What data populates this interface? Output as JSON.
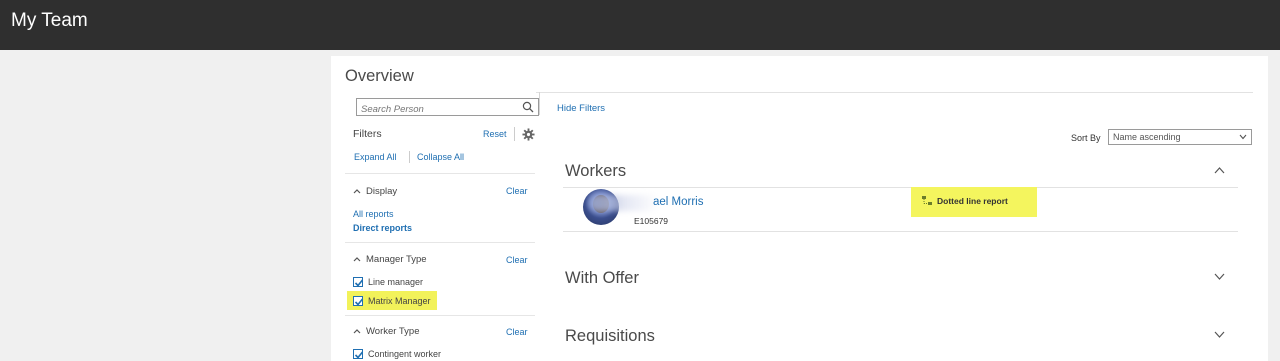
{
  "app": {
    "title": "My Team"
  },
  "overview": {
    "title": "Overview",
    "search_placeholder": "Search Person",
    "hide_filters": "Hide Filters"
  },
  "filters": {
    "label": "Filters",
    "reset": "Reset",
    "expand_all": "Expand All",
    "collapse_all": "Collapse All",
    "display": {
      "label": "Display",
      "clear": "Clear",
      "options": [
        "All reports",
        "Direct reports"
      ],
      "selected": "Direct reports"
    },
    "manager_type": {
      "label": "Manager Type",
      "clear": "Clear",
      "options": [
        {
          "label": "Line manager",
          "checked": true
        },
        {
          "label": "Matrix Manager",
          "checked": true
        }
      ]
    },
    "worker_type": {
      "label": "Worker Type",
      "clear": "Clear",
      "options": [
        {
          "label": "Contingent worker",
          "checked": true
        }
      ]
    }
  },
  "sort": {
    "label": "Sort By",
    "value": "Name ascending"
  },
  "sections": {
    "workers": "Workers",
    "with_offer": "With Offer",
    "requisitions": "Requisitions"
  },
  "worker": {
    "name": "ael Morris",
    "id": "E105679",
    "badge": "Dotted line report"
  },
  "colors": {
    "header_bg": "#2f2f2f",
    "link": "#1f6fb2",
    "highlight": "#f4f55e"
  }
}
